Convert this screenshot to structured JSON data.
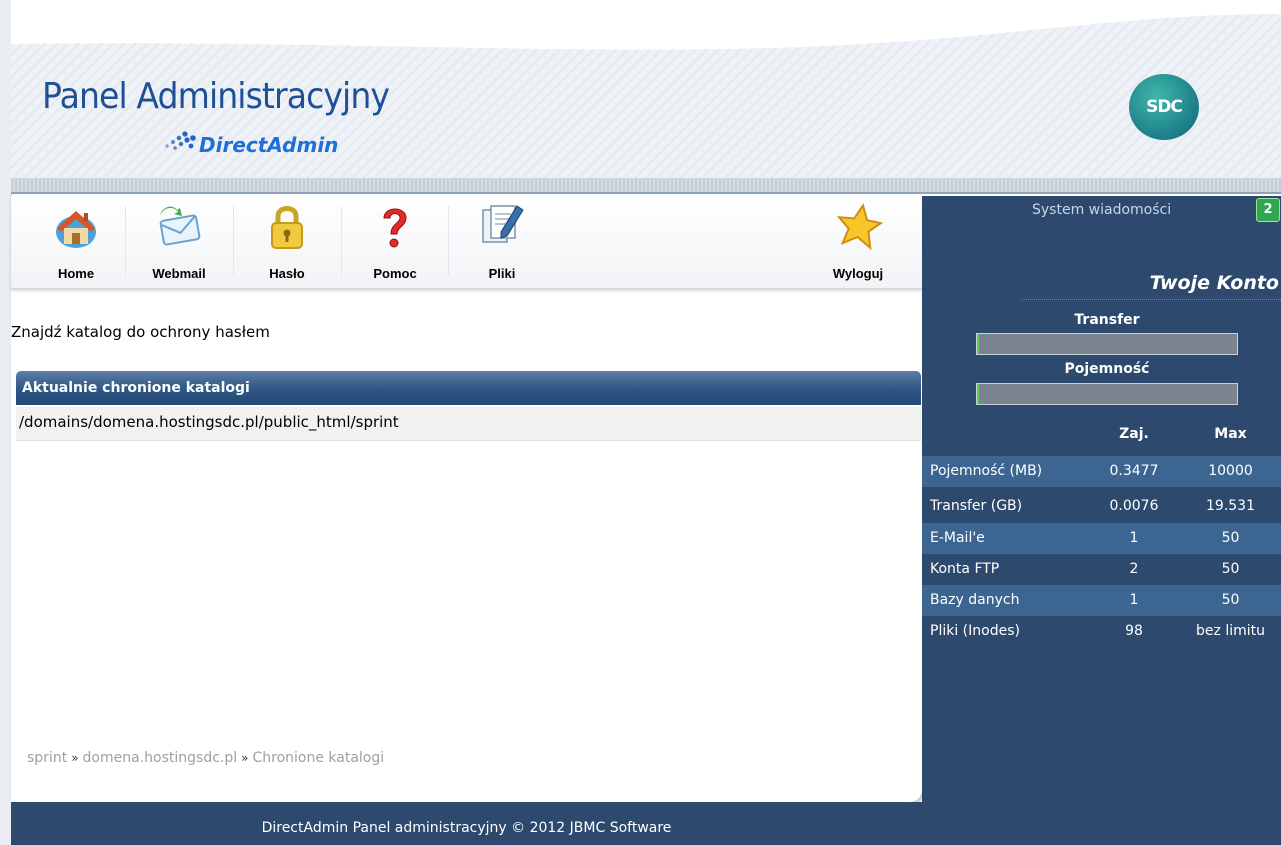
{
  "header": {
    "title": "Panel Administracyjny",
    "subtitle": "DirectAdmin",
    "logo_text": "SDC"
  },
  "toolbar": {
    "items": [
      {
        "label": "Home",
        "icon": "house-icon"
      },
      {
        "label": "Webmail",
        "icon": "envelope-icon"
      },
      {
        "label": "Hasło",
        "icon": "padlock-icon"
      },
      {
        "label": "Pomoc",
        "icon": "question-mark-icon"
      },
      {
        "label": "Pliki",
        "icon": "file-pen-icon"
      }
    ],
    "logout": {
      "label": "Wyloguj",
      "icon": "star-icon"
    }
  },
  "main": {
    "find_link": "Znajdź katalog do ochrony hasłem",
    "section_title": "Aktualnie chronione katalogi",
    "protected_dirs": [
      "/domains/domena.hostingsdc.pl/public_html/sprint"
    ],
    "breadcrumb": [
      "sprint",
      "domena.hostingsdc.pl",
      "Chronione katalogi"
    ],
    "breadcrumb_sep": "»"
  },
  "sidebar": {
    "system_messages_label": "System wiadomości",
    "system_messages_count": "2",
    "account_title": "Twoje Konto",
    "transfer_label": "Transfer",
    "transfer_fraction": 0.004,
    "capacity_label": "Pojemność",
    "capacity_fraction": 0.004,
    "col_used": "Zaj.",
    "col_max": "Max",
    "stats": [
      {
        "name": "Pojemność (MB)",
        "used": "0.3477",
        "max": "10000"
      },
      {
        "name": "Transfer (GB)",
        "used": "0.0076",
        "max": "19.531"
      },
      {
        "name": "E-Mail'e",
        "used": "1",
        "max": "50"
      },
      {
        "name": "Konta FTP",
        "used": "2",
        "max": "50"
      },
      {
        "name": "Bazy danych",
        "used": "1",
        "max": "50"
      },
      {
        "name": "Pliki (Inodes)",
        "used": "98",
        "max": "bez limitu"
      }
    ]
  },
  "footer": {
    "text": "DirectAdmin Panel administracyjny © 2012 JBMC Software"
  },
  "colors": {
    "navy": "#2d4a6e",
    "accent_blue": "#1f4f94",
    "row_alt": "#3d6592",
    "badge_green": "#2fa84f"
  }
}
